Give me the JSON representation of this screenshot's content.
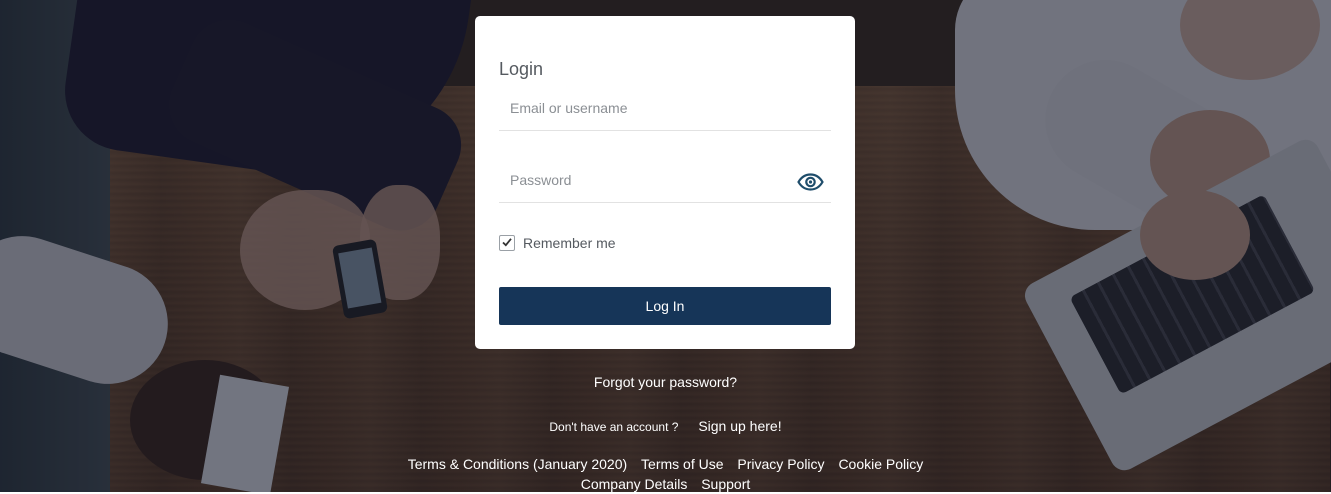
{
  "login": {
    "title": "Login",
    "email_placeholder": "Email or username",
    "password_placeholder": "Password",
    "remember_label": "Remember me",
    "remember_checked": true,
    "login_button": "Log In",
    "show_password_icon": "eye-icon"
  },
  "links": {
    "forgot_password": "Forgot your password?",
    "no_account": "Don't have an account ?",
    "signup": "Sign up here!"
  },
  "footer": {
    "row1": [
      "Terms & Conditions (January 2020)",
      "Terms of Use",
      "Privacy Policy",
      "Cookie Policy"
    ],
    "row2": [
      "Company Details",
      "Support"
    ]
  },
  "colors": {
    "primary_button": "#163558",
    "eye_icon": "#1f4d6b"
  }
}
